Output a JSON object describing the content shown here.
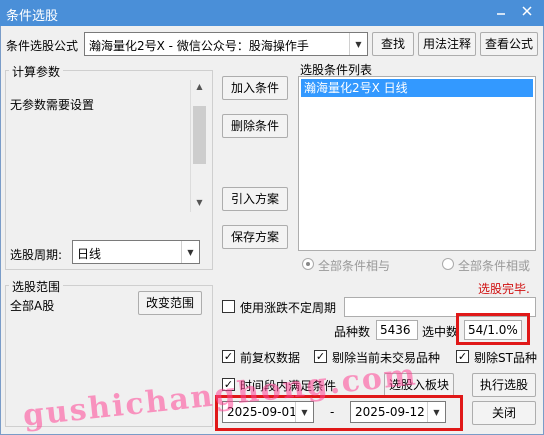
{
  "window": {
    "title": "条件选股"
  },
  "formula": {
    "label": "条件选股公式",
    "value": "瀚海量化2号X  -  微信公众号：股海操作手",
    "find_button": "查找",
    "usage_button": "用法注释",
    "view_button": "查看公式"
  },
  "params": {
    "group_title": "计算参数",
    "text": "无参数需要设置",
    "period_label": "选股周期:",
    "period_value": "日线"
  },
  "actions": {
    "add": "加入条件",
    "delete": "删除条件",
    "import": "引入方案",
    "save": "保存方案"
  },
  "conditions": {
    "title": "选股条件列表",
    "items": [
      "瀚海量化2号X  日线"
    ],
    "radio_and": "全部条件相与",
    "radio_or": "全部条件相或"
  },
  "status": {
    "text": "选股完毕.",
    "color": "#d01010"
  },
  "scope": {
    "group_title": "选股范围",
    "text": "全部A股",
    "change_button": "改变范围"
  },
  "options": {
    "variable_period_label": "使用涨跌不定周期",
    "variable_period_checked": false,
    "count_label": "品种数",
    "count_value": "5436",
    "selected_label": "选中数",
    "selected_value": "54/1.0%",
    "pre_adjust_label": "前复权数据",
    "pre_adjust_checked": true,
    "exclude_untraded_label": "剔除当前未交易品种",
    "exclude_untraded_checked": true,
    "exclude_st_label": "剔除ST品种",
    "exclude_st_checked": true,
    "time_range_label": "时间段内满足条件",
    "time_range_checked": true,
    "add_to_block_button": "选股入板块",
    "execute_button": "执行选股",
    "start_date": "2025-09-01",
    "date_separator": "-",
    "end_date": "2025-09-12",
    "close_button": "关闭"
  },
  "watermark": "gushichanghong.com",
  "colors": {
    "titlebar": "#4a8fd8",
    "selection": "#3399ff",
    "highlight_border": "#e01818"
  }
}
